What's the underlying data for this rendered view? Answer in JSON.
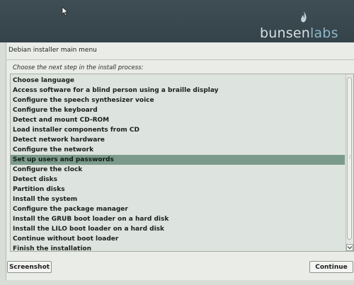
{
  "brand": {
    "part1": "bunsen",
    "part2": "labs"
  },
  "header": {
    "title": "Debian installer main menu"
  },
  "prompt": "Choose the next step in the install process:",
  "menu": {
    "items": [
      "Choose language",
      "Access software for a blind person using a braille display",
      "Configure the speech synthesizer voice",
      "Configure the keyboard",
      "Detect and mount CD-ROM",
      "Load installer components from CD",
      "Detect network hardware",
      "Configure the network",
      "Set up users and passwords",
      "Configure the clock",
      "Detect disks",
      "Partition disks",
      "Install the system",
      "Configure the package manager",
      "Install the GRUB boot loader on a hard disk",
      "Install the LILO boot loader on a hard disk",
      "Continue without boot loader",
      "Finish the installation"
    ],
    "selected": "Set up users and passwords"
  },
  "buttons": {
    "screenshot": "Screenshot",
    "continue": "Continue"
  },
  "colors": {
    "banner": "#3f4e54",
    "selection": "#7b9a8b",
    "list_bg": "#dde3de",
    "accent_labs": "#8fb6c9"
  },
  "icons": {
    "cursor": "mouse-pointer-icon",
    "logo": "flame-icon"
  }
}
